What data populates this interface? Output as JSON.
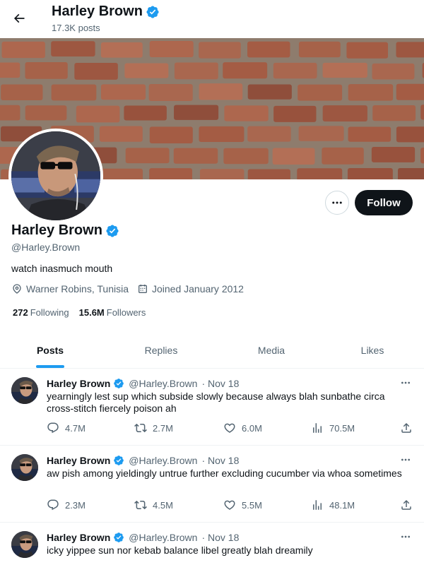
{
  "header": {
    "title": "Harley Brown",
    "posts_count": "17.3K posts"
  },
  "profile": {
    "name": "Harley Brown",
    "handle": "@Harley.Brown",
    "bio": "watch inasmuch mouth",
    "location": "Warner Robins, Tunisia",
    "joined": "Joined January 2012",
    "following_count": "272",
    "following_label": "Following",
    "followers_count": "15.6M",
    "followers_label": "Followers",
    "follow_label": "Follow"
  },
  "tabs": [
    {
      "label": "Posts",
      "active": true
    },
    {
      "label": "Replies",
      "active": false
    },
    {
      "label": "Media",
      "active": false
    },
    {
      "label": "Likes",
      "active": false
    }
  ],
  "tweets": [
    {
      "name": "Harley Brown",
      "handle": "@Harley.Brown",
      "date": "· Nov 18",
      "text": "yearningly lest sup which subside slowly because always blah sunbathe circa cross-stitch fiercely poison ah",
      "replies": "4.7M",
      "retweets": "2.7M",
      "likes": "6.0M",
      "views": "70.5M"
    },
    {
      "name": "Harley Brown",
      "handle": "@Harley.Brown",
      "date": "· Nov 18",
      "text": "aw pish among yieldingly untrue further excluding cucumber via whoa sometimes",
      "replies": "2.3M",
      "retweets": "4.5M",
      "likes": "5.5M",
      "views": "48.1M"
    },
    {
      "name": "Harley Brown",
      "handle": "@Harley.Brown",
      "date": "· Nov 18",
      "text": "icky yippee sun nor kebab balance libel greatly blah dreamily"
    }
  ],
  "colors": {
    "accent": "#1d9bf0",
    "text_primary": "#0f1419",
    "text_secondary": "#536471",
    "verified": "#1d9bf0",
    "follow_button_bg": "#0f1419"
  },
  "icons": {
    "back": "arrow-left-icon",
    "verified": "verified-badge-icon",
    "more": "more-horizontal-icon",
    "location": "location-pin-icon",
    "calendar": "calendar-icon",
    "reply": "reply-bubble-icon",
    "retweet": "retweet-icon",
    "like": "heart-icon",
    "views": "views-bar-chart-icon",
    "share": "share-upload-icon"
  }
}
